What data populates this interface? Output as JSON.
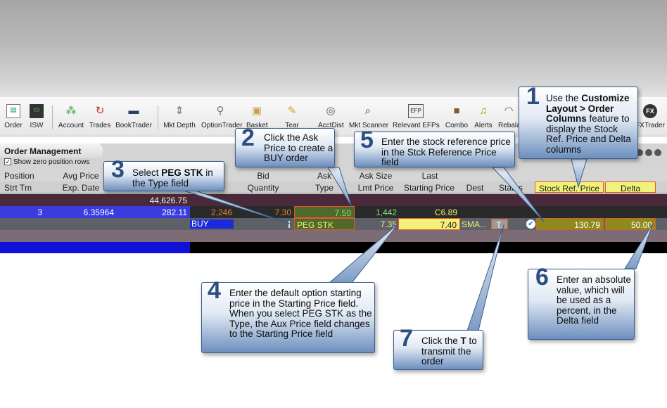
{
  "toolbar": {
    "items": [
      {
        "label": "Order",
        "icon": "order-icon"
      },
      {
        "label": "ISW",
        "icon": "isw-icon"
      },
      {
        "label": "Account",
        "icon": "account-icon"
      },
      {
        "label": "Trades",
        "icon": "trades-icon"
      },
      {
        "label": "BookTrader",
        "icon": "booktrader-icon"
      },
      {
        "label": "Mkt Depth",
        "icon": "mkt-depth-icon"
      },
      {
        "label": "OptionTrader",
        "icon": "optiontrader-icon"
      },
      {
        "label": "Basket",
        "icon": "basket-icon"
      },
      {
        "label": "Tear",
        "icon": "tear-icon"
      },
      {
        "label": "AcctDist",
        "icon": "acctdist-icon"
      },
      {
        "label": "Mkt Scanner",
        "icon": "mkt-scanner-icon"
      },
      {
        "label": "Relevant EFPs",
        "icon": "efp-icon"
      },
      {
        "label": "Combo",
        "icon": "combo-icon"
      },
      {
        "label": "Alerts",
        "icon": "alerts-icon"
      },
      {
        "label": "Rebala",
        "icon": "rebalance-icon"
      },
      {
        "label": "FXTrader",
        "icon": "fxtrader-icon"
      }
    ],
    "efp_badge": "EFP",
    "fx_badge": "FX"
  },
  "order_management": {
    "tab_title": "Order Management",
    "show_zero_label": "Show zero position rows",
    "header_row1": [
      "Position",
      "Avg Price",
      "ize",
      "Bid",
      "Ask",
      "Ask Size",
      "Last"
    ],
    "header_row2": [
      "Strt Tm",
      "Exp. Date",
      "n",
      "Quantity",
      "Type",
      "Lmt Price",
      "Starting Price",
      "Dest",
      "Status",
      "Stock Ref. Price",
      "Delta"
    ],
    "total_row": {
      "value": "44,626.75"
    },
    "position_row": {
      "position": "3",
      "avg_price": "6.35964",
      "market_value": "282.11",
      "bid_size": "2,246",
      "bid": "7.30",
      "ask": "7.50",
      "ask_size": "1,442",
      "last": "C6.89"
    },
    "order_row": {
      "action": "BUY",
      "type": "PEG STK",
      "lmt_price": "7.35",
      "starting_price": "7.40",
      "dest": "SMA...",
      "transmit": "T.",
      "stock_ref_price": "130.79",
      "delta": "50.00"
    }
  },
  "callouts": [
    {
      "number": "1",
      "text_before": "Use the ",
      "bold": "Customize Layout > Order Columns",
      "text_after": " feature to display the Stock Ref. Price and Delta columns"
    },
    {
      "number": "2",
      "text": "Click the Ask Price to create a BUY order"
    },
    {
      "number": "3",
      "text_before": "Select ",
      "bold": "PEG STK",
      "text_after": " in the Type field"
    },
    {
      "number": "4",
      "text": "Enter the default option starting price in the Starting Price field. When you select PEG STK as the Type, the Aux Price field changes to the Starting Price field"
    },
    {
      "number": "5",
      "text": "Enter the stock reference price in the Stck Reference Price field"
    },
    {
      "number": "6",
      "text": "Enter an absolute value, which will be used as a percent, in the Delta field"
    },
    {
      "number": "7",
      "text_before": "Click the ",
      "bold": "T",
      "text_after": " to transmit the order"
    }
  ],
  "colors": {
    "callout_number": "#2c4e80",
    "highlight_outline": "#e8582a",
    "ask_green": "#7fe07f",
    "bid_orange": "#e08030",
    "buy_blue": "#1b2bdc",
    "yellow_cell": "#f2f27a"
  }
}
